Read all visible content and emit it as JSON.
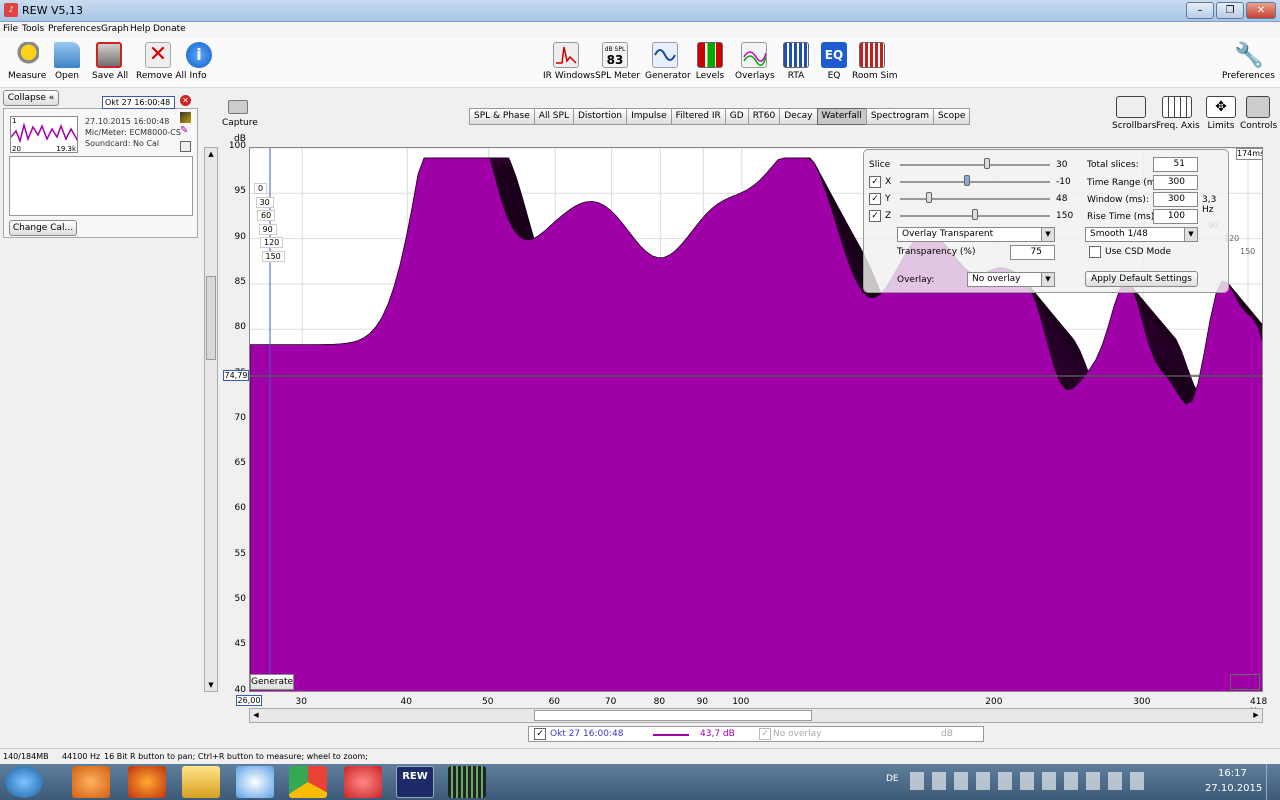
{
  "window": {
    "title": "REW V5,13"
  },
  "menu": [
    "File",
    "Tools",
    "Preferences",
    "Graph",
    "Help",
    "Donate"
  ],
  "toolbar_left": [
    {
      "label": "Measure",
      "icon": "measure-icon"
    },
    {
      "label": "Open",
      "icon": "folder-icon"
    },
    {
      "label": "Save All",
      "icon": "save-icon"
    },
    {
      "label": "Remove All",
      "icon": "remove-icon"
    },
    {
      "label": "Info",
      "icon": "info-icon"
    }
  ],
  "toolbar_center": [
    {
      "label": "IR Windows",
      "icon": "ir-windows-icon"
    },
    {
      "label": "SPL Meter",
      "icon": "spl-meter-icon",
      "badge_top": "dB SPL",
      "badge_val": "83"
    },
    {
      "label": "Generator",
      "icon": "generator-icon"
    },
    {
      "label": "Levels",
      "icon": "levels-icon"
    },
    {
      "label": "Overlays",
      "icon": "overlays-icon"
    },
    {
      "label": "RTA",
      "icon": "rta-icon"
    },
    {
      "label": "EQ",
      "icon": "eq-icon",
      "text": "EQ"
    },
    {
      "label": "Room Sim",
      "icon": "room-sim-icon"
    }
  ],
  "toolbar_right": {
    "label": "Preferences"
  },
  "left_panel": {
    "collapse_label": "Collapse",
    "measurement_name": "Okt 27 16:00:48",
    "date": "27.10.2015 16:00:48",
    "mic": "Mic/Meter: ECM8000-CS",
    "soundcard": "Soundcard: No Cal",
    "thumb_tl": "1",
    "thumb_bl": "20",
    "thumb_br": "19.3k",
    "change_cal": "Change Cal..."
  },
  "capture": {
    "label": "Capture"
  },
  "graph_tabs": [
    {
      "label": "SPL & Phase",
      "active": false
    },
    {
      "label": "All SPL",
      "active": false
    },
    {
      "label": "Distortion",
      "active": false
    },
    {
      "label": "Impulse",
      "active": false
    },
    {
      "label": "Filtered IR",
      "active": false
    },
    {
      "label": "GD",
      "active": false
    },
    {
      "label": "RT60",
      "active": false
    },
    {
      "label": "Decay",
      "active": false
    },
    {
      "label": "Waterfall",
      "active": true
    },
    {
      "label": "Spectrogram",
      "active": false
    },
    {
      "label": "Scope",
      "active": false
    }
  ],
  "graph_tools": [
    {
      "label": "Scrollbars",
      "icon": "scrollbars-icon"
    },
    {
      "label": "Freq. Axis",
      "icon": "freq-axis-icon"
    },
    {
      "label": "Limits",
      "icon": "limits-icon"
    },
    {
      "label": "Controls",
      "icon": "controls-icon"
    }
  ],
  "plot": {
    "y_unit": "dB",
    "y_ticks": [
      "100",
      "95",
      "90",
      "85",
      "80",
      "75",
      "70",
      "65",
      "60",
      "55",
      "50",
      "45",
      "40"
    ],
    "x_ticks": [
      "30",
      "40",
      "50",
      "60",
      "70",
      "80",
      "90",
      "100",
      "200",
      "300"
    ],
    "x_unit": "418 Hz",
    "cursor_y": "74,79",
    "cursor_x": "26,00",
    "time_label": "174ms",
    "depth_labels": [
      "0",
      "30",
      "60",
      "90",
      "120",
      "150"
    ],
    "depth_right": [
      "90",
      "120",
      "150"
    ],
    "generate_label": "Generate",
    "fill_color": "#a000a8",
    "line_color": "#1a001a"
  },
  "controls": {
    "slice_label": "Slice",
    "slice_val": "30",
    "x_label": "X",
    "x_val": "-10",
    "y_label": "Y",
    "y_val": "48",
    "z_label": "Z",
    "z_val": "150",
    "overlay_mode": "Overlay Transparent",
    "transparency_label": "Transparency (%)",
    "transparency_val": "75",
    "overlay_label": "Overlay:",
    "overlay_val": "No overlay",
    "total_slices_label": "Total slices:",
    "total_slices_val": "51",
    "time_range_label": "Time Range (ms):",
    "time_range_val": "300",
    "window_label": "Window (ms):",
    "window_val": "300",
    "window_hz": "3,3 Hz",
    "rise_label": "Rise Time (ms):",
    "rise_val": "100",
    "smooth_val": "Smooth 1/48",
    "csd_label": "Use CSD Mode",
    "apply_label": "Apply Default Settings"
  },
  "legend": {
    "name": "Okt 27 16:00:48",
    "value": "43,7 dB",
    "overlay": "No overlay",
    "overlay_unit": "dB"
  },
  "status": {
    "mem": "140/184MB",
    "rate": "44100 Hz",
    "bits": "16 Bit",
    "hint": "R button to pan; Ctrl+R button to measure; wheel to zoom;"
  },
  "taskbar": {
    "lang": "DE",
    "time": "16:17",
    "date": "27.10.2015",
    "rew_label": "REW"
  }
}
